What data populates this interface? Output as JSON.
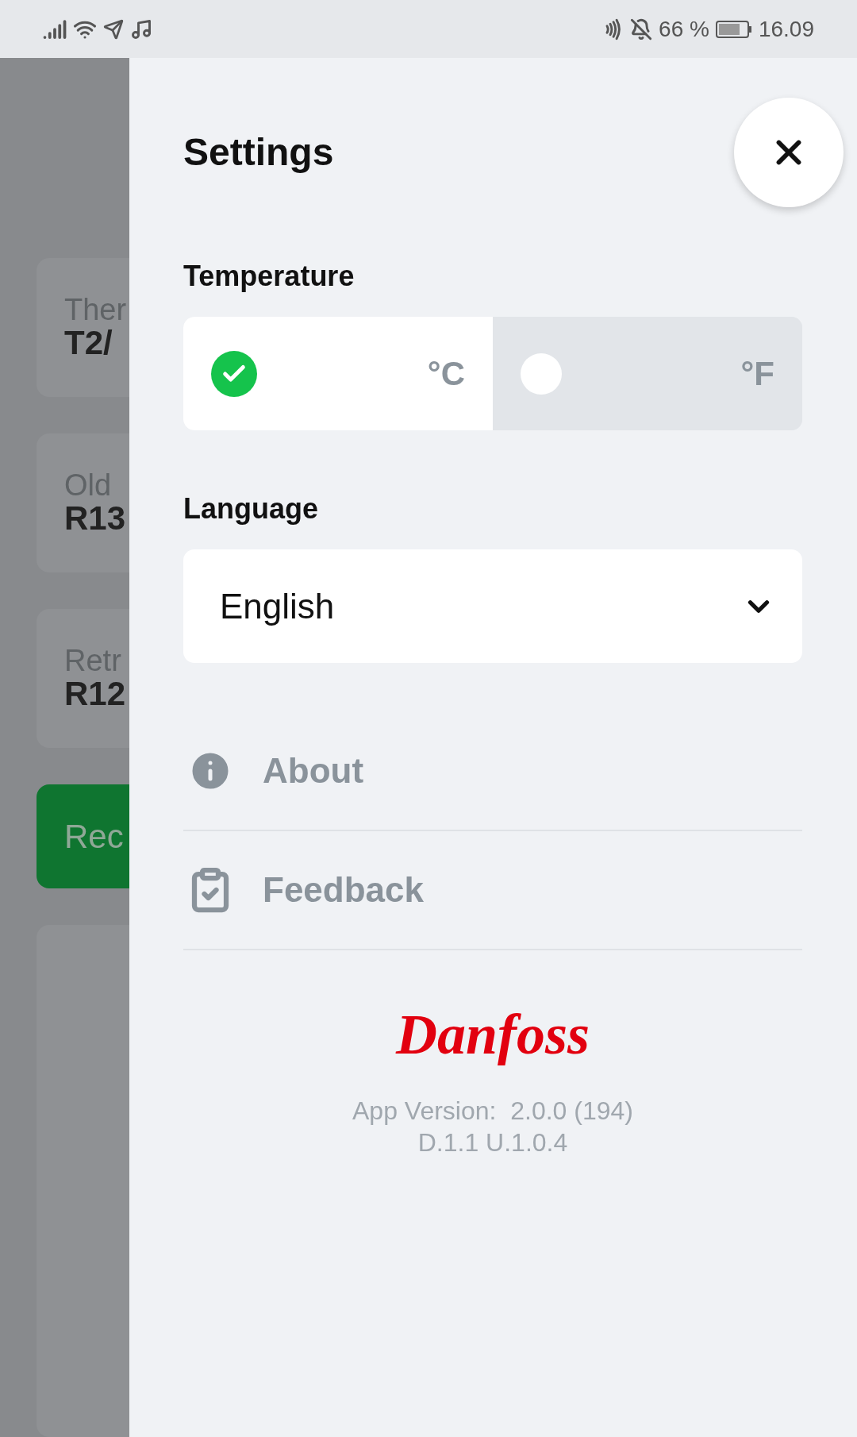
{
  "status_bar": {
    "battery": "66 %",
    "time": "16.09"
  },
  "background": {
    "cards": [
      {
        "label": "Ther",
        "value": "T2/"
      },
      {
        "label": "Old",
        "value": "R13"
      },
      {
        "label": "Retr",
        "value": "R12"
      }
    ],
    "button": "Rec"
  },
  "settings": {
    "title": "Settings",
    "temperature": {
      "label": "Temperature",
      "options": [
        {
          "label": "°C",
          "selected": true
        },
        {
          "label": "°F",
          "selected": false
        }
      ]
    },
    "language": {
      "label": "Language",
      "value": "English"
    },
    "menu": [
      {
        "kind": "info",
        "label": "About"
      },
      {
        "kind": "feedback",
        "label": "Feedback"
      }
    ],
    "logo": "Danfoss",
    "version_lines": [
      "App Version:  2.0.0 (194)",
      "D.1.1 U.1.0.4"
    ]
  }
}
